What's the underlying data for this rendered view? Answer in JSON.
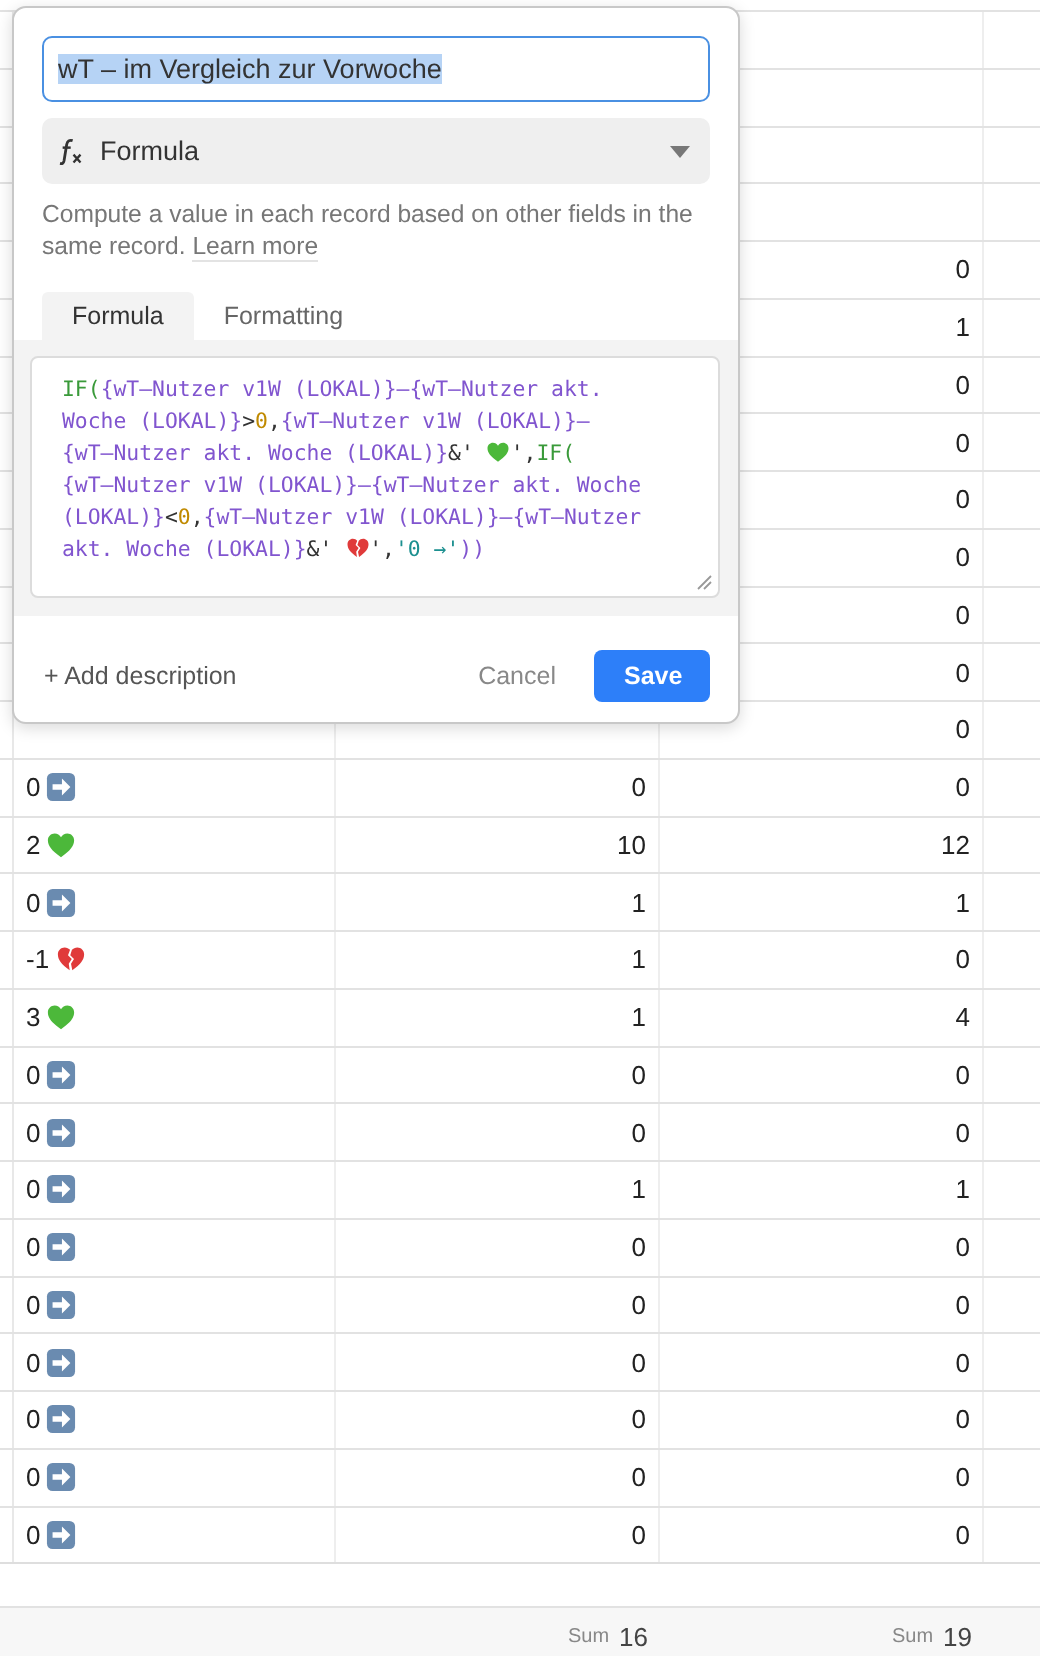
{
  "table": {
    "rows": [
      {},
      {},
      {},
      {},
      {
        "column_3": {
          "value": "0"
        }
      },
      {
        "column_3": {
          "value": "1"
        }
      },
      {
        "column_3": {
          "value": "0"
        }
      },
      {
        "column_3": {
          "value": "0"
        }
      },
      {
        "column_3": {
          "value": "0"
        }
      },
      {
        "column_3": {
          "value": "0"
        }
      },
      {
        "column_3": {
          "value": "0"
        }
      },
      {
        "column_3": {
          "value": "0"
        }
      },
      {
        "column_3": {
          "value": "0"
        }
      },
      {
        "column_1": {
          "value": "0",
          "kind": "arrow"
        },
        "column_2": {
          "value": "0"
        },
        "column_3": {
          "value": "0"
        }
      },
      {
        "column_1": {
          "value": "2",
          "kind": "heart"
        },
        "column_2": {
          "value": "10"
        },
        "column_3": {
          "value": "12"
        }
      },
      {
        "column_1": {
          "value": "0",
          "kind": "arrow"
        },
        "column_2": {
          "value": "1"
        },
        "column_3": {
          "value": "1"
        }
      },
      {
        "column_1": {
          "value": "-1",
          "kind": "brokenheart"
        },
        "column_2": {
          "value": "1"
        },
        "column_3": {
          "value": "0"
        }
      },
      {
        "column_1": {
          "value": "3",
          "kind": "heart"
        },
        "column_2": {
          "value": "1"
        },
        "column_3": {
          "value": "4"
        }
      },
      {
        "column_1": {
          "value": "0",
          "kind": "arrow"
        },
        "column_2": {
          "value": "0"
        },
        "column_3": {
          "value": "0"
        }
      },
      {
        "column_1": {
          "value": "0",
          "kind": "arrow"
        },
        "column_2": {
          "value": "0"
        },
        "column_3": {
          "value": "0"
        }
      },
      {
        "column_1": {
          "value": "0",
          "kind": "arrow"
        },
        "column_2": {
          "value": "1"
        },
        "column_3": {
          "value": "1"
        }
      },
      {
        "column_1": {
          "value": "0",
          "kind": "arrow"
        },
        "column_2": {
          "value": "0"
        },
        "column_3": {
          "value": "0"
        }
      },
      {
        "column_1": {
          "value": "0",
          "kind": "arrow"
        },
        "column_2": {
          "value": "0"
        },
        "column_3": {
          "value": "0"
        }
      },
      {
        "column_1": {
          "value": "0",
          "kind": "arrow"
        },
        "column_2": {
          "value": "0"
        },
        "column_3": {
          "value": "0"
        }
      },
      {
        "column_1": {
          "value": "0",
          "kind": "arrow"
        },
        "column_2": {
          "value": "0"
        },
        "column_3": {
          "value": "0"
        }
      },
      {
        "column_1": {
          "value": "0",
          "kind": "arrow"
        },
        "column_2": {
          "value": "0"
        },
        "column_3": {
          "value": "0"
        }
      },
      {
        "column_1": {
          "value": "0",
          "kind": "arrow"
        },
        "column_2": {
          "value": "0"
        },
        "column_3": {
          "value": "0"
        }
      }
    ],
    "sums": [
      {
        "label": "Sum",
        "value": "16"
      },
      {
        "label": "Sum",
        "value": "19"
      }
    ]
  },
  "field_editor": {
    "name": {
      "value": "wT – im Vergleich zur Vorwoche",
      "text_selected": true
    },
    "type": {
      "label": "Formula"
    },
    "description": {
      "text": "Compute a value in each record based on other fields in the same record.",
      "link": "Learn more"
    },
    "tabs": [
      {
        "label": "Formula",
        "selected": true
      },
      {
        "label": "Formatting",
        "selected": false
      }
    ],
    "formula_lines": [
      [
        {
          "kind": "function",
          "text": "IF("
        },
        {
          "kind": "field",
          "text": "{wT–Nutzer v1W (LOKAL)}–{wT–Nutzer akt."
        }
      ],
      [
        {
          "kind": "field",
          "text": "Woche (LOKAL)}"
        },
        {
          "kind": "operator",
          "text": ">"
        },
        {
          "kind": "number",
          "text": "0"
        },
        {
          "kind": "operator",
          "text": ","
        },
        {
          "kind": "field",
          "text": "{wT–Nutzer v1W (LOKAL)}–"
        }
      ],
      [
        {
          "kind": "field",
          "text": "{wT–Nutzer akt. Woche (LOKAL)}"
        },
        {
          "kind": "operator",
          "text": "&' "
        },
        {
          "kind": "heart"
        },
        {
          "kind": "operator",
          "text": "',"
        },
        {
          "kind": "function",
          "text": "IF("
        }
      ],
      [
        {
          "kind": "field",
          "text": "{wT–Nutzer v1W (LOKAL)}–{wT–Nutzer akt. Woche"
        }
      ],
      [
        {
          "kind": "field",
          "text": "(LOKAL)}"
        },
        {
          "kind": "operator",
          "text": "<"
        },
        {
          "kind": "number",
          "text": "0"
        },
        {
          "kind": "operator",
          "text": ","
        },
        {
          "kind": "field",
          "text": "{wT–Nutzer v1W (LOKAL)}–{wT–Nutzer"
        }
      ],
      [
        {
          "kind": "field",
          "text": "akt. Woche (LOKAL)}"
        },
        {
          "kind": "operator",
          "text": "&' "
        },
        {
          "kind": "brokenheart"
        },
        {
          "kind": "operator",
          "text": "',"
        },
        {
          "kind": "string",
          "text": "'0 →'"
        },
        {
          "kind": "field",
          "text": "))"
        }
      ]
    ],
    "add_description": "+ Add description",
    "buttons": [
      {
        "label": "Cancel",
        "kind": "secondary"
      },
      {
        "label": "Save",
        "kind": "primary"
      }
    ]
  }
}
